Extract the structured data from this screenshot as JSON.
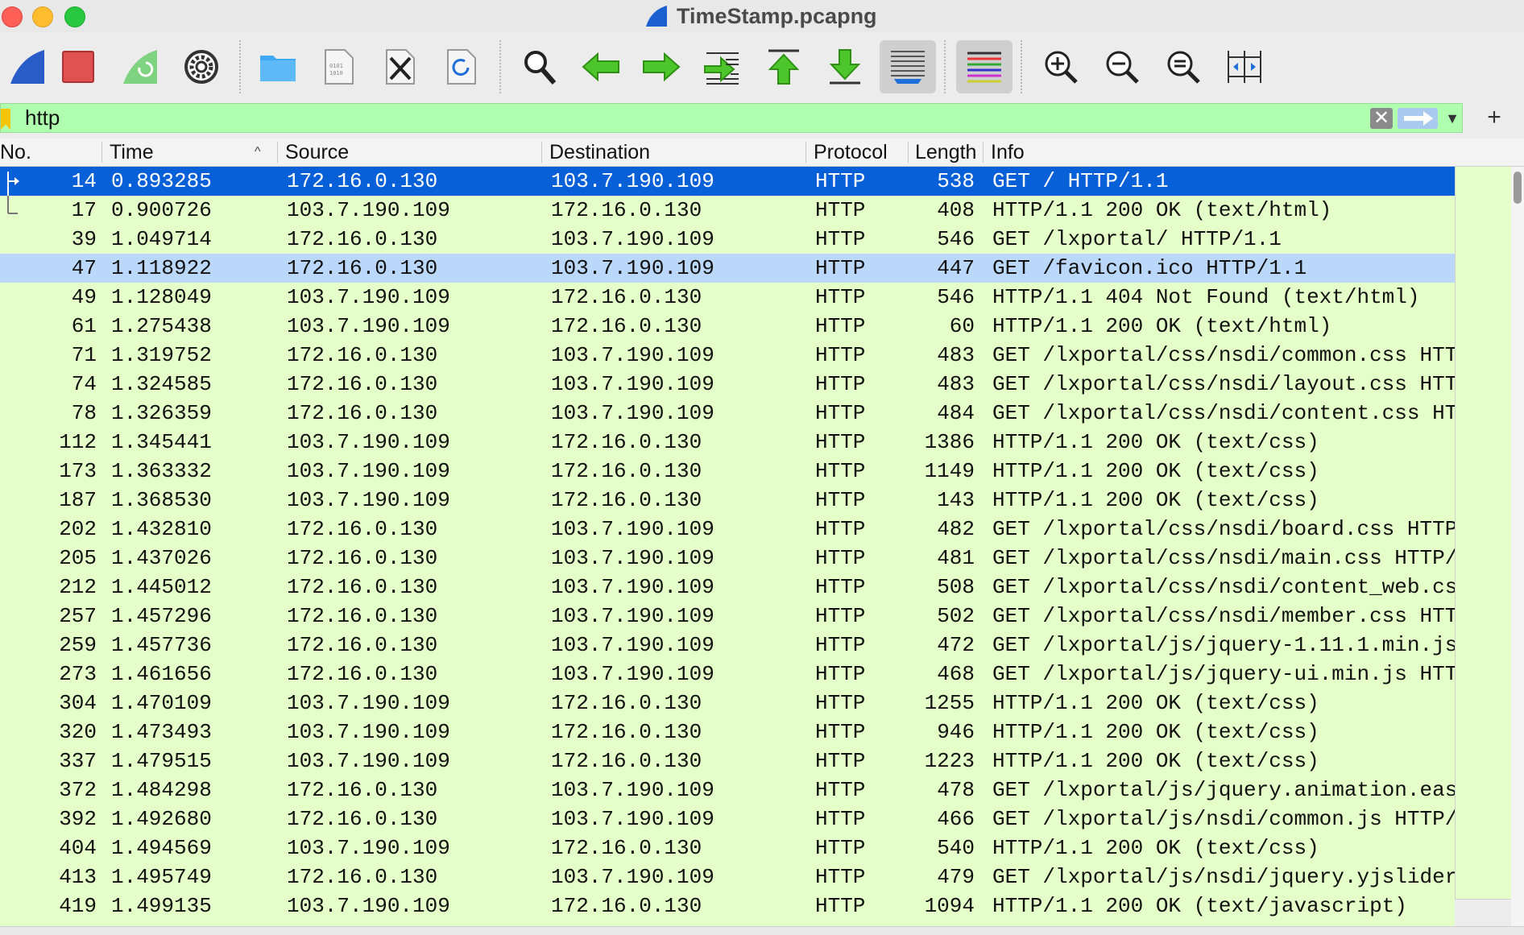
{
  "window": {
    "title": "TimeStamp.pcapng"
  },
  "toolbar": {
    "buttons": [
      {
        "name": "start-capture",
        "icon": "shark-fin-icon"
      },
      {
        "name": "stop-capture",
        "icon": "stop-square-icon"
      },
      {
        "name": "restart-capture",
        "icon": "restart-fin-icon"
      },
      {
        "name": "capture-options",
        "icon": "gear-icon"
      },
      {
        "name": "open-file",
        "icon": "folder-icon"
      },
      {
        "name": "save-file",
        "icon": "binary-file-icon"
      },
      {
        "name": "close-file",
        "icon": "close-file-icon"
      },
      {
        "name": "reload-file",
        "icon": "reload-file-icon"
      },
      {
        "name": "find-packet",
        "icon": "magnifier-icon"
      },
      {
        "name": "go-back",
        "icon": "green-arrow-left-icon"
      },
      {
        "name": "go-forward",
        "icon": "green-arrow-right-icon"
      },
      {
        "name": "go-to-packet",
        "icon": "jump-to-packet-icon"
      },
      {
        "name": "go-first-packet",
        "icon": "arrow-up-to-top-icon"
      },
      {
        "name": "go-last-packet",
        "icon": "arrow-down-to-bottom-icon"
      },
      {
        "name": "auto-scroll",
        "icon": "auto-scroll-icon"
      },
      {
        "name": "colorize",
        "icon": "colorize-lines-icon"
      },
      {
        "name": "zoom-in",
        "icon": "zoom-in-icon"
      },
      {
        "name": "zoom-out",
        "icon": "zoom-out-icon"
      },
      {
        "name": "normal-size",
        "icon": "zoom-reset-icon"
      },
      {
        "name": "resize-columns",
        "icon": "resize-columns-icon"
      }
    ]
  },
  "filter": {
    "value": "http",
    "clear_icon": "clear-x-icon",
    "apply_icon": "apply-arrow-icon",
    "dropdown_icon": "chevron-down-icon",
    "add_icon": "plus-icon"
  },
  "columns": {
    "no": "No.",
    "time": "Time",
    "source": "Source",
    "destination": "Destination",
    "protocol": "Protocol",
    "length": "Length",
    "info": "Info"
  },
  "colors": {
    "row_bg": "#e4ffc7",
    "selected_bg": "#0860d8",
    "related_bg": "#bbd8fb",
    "filter_bg": "#afffaf"
  },
  "packets": [
    {
      "no": "14",
      "time": "0.893285",
      "src": "172.16.0.130",
      "dst": "103.7.190.109",
      "proto": "HTTP",
      "len": "538",
      "info": "GET / HTTP/1.1",
      "state": "selected"
    },
    {
      "no": "17",
      "time": "0.900726",
      "src": "103.7.190.109",
      "dst": "172.16.0.130",
      "proto": "HTTP",
      "len": "408",
      "info": "HTTP/1.1 200 OK  (text/html)",
      "state": "related"
    },
    {
      "no": "39",
      "time": "1.049714",
      "src": "172.16.0.130",
      "dst": "103.7.190.109",
      "proto": "HTTP",
      "len": "546",
      "info": "GET /lxportal/ HTTP/1.1",
      "state": ""
    },
    {
      "no": "47",
      "time": "1.118922",
      "src": "172.16.0.130",
      "dst": "103.7.190.109",
      "proto": "HTTP",
      "len": "447",
      "info": "GET /favicon.ico HTTP/1.1",
      "state": "highlight"
    },
    {
      "no": "49",
      "time": "1.128049",
      "src": "103.7.190.109",
      "dst": "172.16.0.130",
      "proto": "HTTP",
      "len": "546",
      "info": "HTTP/1.1 404 Not Found  (text/html)",
      "state": ""
    },
    {
      "no": "61",
      "time": "1.275438",
      "src": "103.7.190.109",
      "dst": "172.16.0.130",
      "proto": "HTTP",
      "len": "60",
      "info": "HTTP/1.1 200 OK  (text/html)",
      "state": ""
    },
    {
      "no": "71",
      "time": "1.319752",
      "src": "172.16.0.130",
      "dst": "103.7.190.109",
      "proto": "HTTP",
      "len": "483",
      "info": "GET /lxportal/css/nsdi/common.css HTT",
      "state": ""
    },
    {
      "no": "74",
      "time": "1.324585",
      "src": "172.16.0.130",
      "dst": "103.7.190.109",
      "proto": "HTTP",
      "len": "483",
      "info": "GET /lxportal/css/nsdi/layout.css HTT",
      "state": ""
    },
    {
      "no": "78",
      "time": "1.326359",
      "src": "172.16.0.130",
      "dst": "103.7.190.109",
      "proto": "HTTP",
      "len": "484",
      "info": "GET /lxportal/css/nsdi/content.css HT",
      "state": ""
    },
    {
      "no": "112",
      "time": "1.345441",
      "src": "103.7.190.109",
      "dst": "172.16.0.130",
      "proto": "HTTP",
      "len": "1386",
      "info": "HTTP/1.1 200 OK  (text/css)",
      "state": ""
    },
    {
      "no": "173",
      "time": "1.363332",
      "src": "103.7.190.109",
      "dst": "172.16.0.130",
      "proto": "HTTP",
      "len": "1149",
      "info": "HTTP/1.1 200 OK  (text/css)",
      "state": ""
    },
    {
      "no": "187",
      "time": "1.368530",
      "src": "103.7.190.109",
      "dst": "172.16.0.130",
      "proto": "HTTP",
      "len": "143",
      "info": "HTTP/1.1 200 OK  (text/css)",
      "state": ""
    },
    {
      "no": "202",
      "time": "1.432810",
      "src": "172.16.0.130",
      "dst": "103.7.190.109",
      "proto": "HTTP",
      "len": "482",
      "info": "GET /lxportal/css/nsdi/board.css HTTP",
      "state": ""
    },
    {
      "no": "205",
      "time": "1.437026",
      "src": "172.16.0.130",
      "dst": "103.7.190.109",
      "proto": "HTTP",
      "len": "481",
      "info": "GET /lxportal/css/nsdi/main.css HTTP/",
      "state": ""
    },
    {
      "no": "212",
      "time": "1.445012",
      "src": "172.16.0.130",
      "dst": "103.7.190.109",
      "proto": "HTTP",
      "len": "508",
      "info": "GET /lxportal/css/nsdi/content_web.cs",
      "state": ""
    },
    {
      "no": "257",
      "time": "1.457296",
      "src": "172.16.0.130",
      "dst": "103.7.190.109",
      "proto": "HTTP",
      "len": "502",
      "info": "GET /lxportal/css/nsdi/member.css HTT",
      "state": ""
    },
    {
      "no": "259",
      "time": "1.457736",
      "src": "172.16.0.130",
      "dst": "103.7.190.109",
      "proto": "HTTP",
      "len": "472",
      "info": "GET /lxportal/js/jquery-1.11.1.min.js",
      "state": ""
    },
    {
      "no": "273",
      "time": "1.461656",
      "src": "172.16.0.130",
      "dst": "103.7.190.109",
      "proto": "HTTP",
      "len": "468",
      "info": "GET /lxportal/js/jquery-ui.min.js HTT",
      "state": ""
    },
    {
      "no": "304",
      "time": "1.470109",
      "src": "103.7.190.109",
      "dst": "172.16.0.130",
      "proto": "HTTP",
      "len": "1255",
      "info": "HTTP/1.1 200 OK  (text/css)",
      "state": ""
    },
    {
      "no": "320",
      "time": "1.473493",
      "src": "103.7.190.109",
      "dst": "172.16.0.130",
      "proto": "HTTP",
      "len": "946",
      "info": "HTTP/1.1 200 OK  (text/css)",
      "state": ""
    },
    {
      "no": "337",
      "time": "1.479515",
      "src": "103.7.190.109",
      "dst": "172.16.0.130",
      "proto": "HTTP",
      "len": "1223",
      "info": "HTTP/1.1 200 OK  (text/css)",
      "state": ""
    },
    {
      "no": "372",
      "time": "1.484298",
      "src": "172.16.0.130",
      "dst": "103.7.190.109",
      "proto": "HTTP",
      "len": "478",
      "info": "GET /lxportal/js/jquery.animation.eas",
      "state": ""
    },
    {
      "no": "392",
      "time": "1.492680",
      "src": "172.16.0.130",
      "dst": "103.7.190.109",
      "proto": "HTTP",
      "len": "466",
      "info": "GET /lxportal/js/nsdi/common.js HTTP/",
      "state": ""
    },
    {
      "no": "404",
      "time": "1.494569",
      "src": "103.7.190.109",
      "dst": "172.16.0.130",
      "proto": "HTTP",
      "len": "540",
      "info": "HTTP/1.1 200 OK  (text/css)",
      "state": ""
    },
    {
      "no": "413",
      "time": "1.495749",
      "src": "172.16.0.130",
      "dst": "103.7.190.109",
      "proto": "HTTP",
      "len": "479",
      "info": "GET /lxportal/js/nsdi/jquery.yjslider",
      "state": ""
    },
    {
      "no": "419",
      "time": "1.499135",
      "src": "103.7.190.109",
      "dst": "172.16.0.130",
      "proto": "HTTP",
      "len": "1094",
      "info": "HTTP/1.1 200 OK  (text/javascript)",
      "state": ""
    }
  ]
}
